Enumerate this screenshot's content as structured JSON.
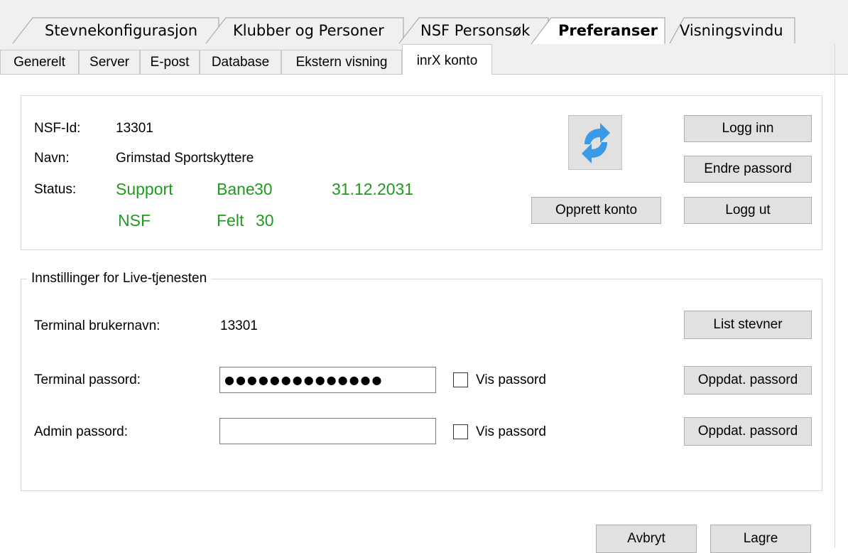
{
  "top_tabs": [
    {
      "label": "Stevnekonfigurasjon",
      "active": false
    },
    {
      "label": "Klubber og Personer",
      "active": false
    },
    {
      "label": "NSF Personsøk",
      "active": false
    },
    {
      "label": "Preferanser",
      "active": true
    },
    {
      "label": "Visningsvindu",
      "active": false
    }
  ],
  "sub_tabs": [
    {
      "label": "Generelt"
    },
    {
      "label": "Server"
    },
    {
      "label": "E-post"
    },
    {
      "label": "Database"
    },
    {
      "label": "Ekstern visning"
    },
    {
      "label": "inrX konto",
      "active": true
    }
  ],
  "account": {
    "nsf_id_label": "NSF-Id:",
    "nsf_id_value": "13301",
    "navn_label": "Navn:",
    "navn_value": "Grimstad Sportskyttere",
    "status_label": "Status:",
    "status": {
      "support": "Support",
      "bane": "Bane",
      "bane_value": "30",
      "date": "31.12.2031",
      "nsf": "NSF",
      "felt": "Felt",
      "felt_value": "30"
    },
    "refresh_icon": "refresh-icon",
    "buttons": {
      "logg_inn": "Logg inn",
      "endre_passord": "Endre passord",
      "opprett_konto": "Opprett konto",
      "logg_ut": "Logg ut"
    }
  },
  "live": {
    "legend": "Innstillinger for Live-tjenesten",
    "terminal_user_label": "Terminal brukernavn:",
    "terminal_user_value": "13301",
    "list_stevner": "List stevner",
    "terminal_pw_label": "Terminal passord:",
    "terminal_pw_value": "●●●●●●●●●●●●●●",
    "admin_pw_label": "Admin passord:",
    "admin_pw_value": "",
    "vis_passord": "Vis passord",
    "oppdat_passord": "Oppdat. passord"
  },
  "footer": {
    "avbryt": "Avbryt",
    "lagre": "Lagre"
  },
  "colors": {
    "status_green": "#1f9a1f",
    "button_bg": "#e1e1e1",
    "refresh_blue": "#3a9ae8"
  }
}
